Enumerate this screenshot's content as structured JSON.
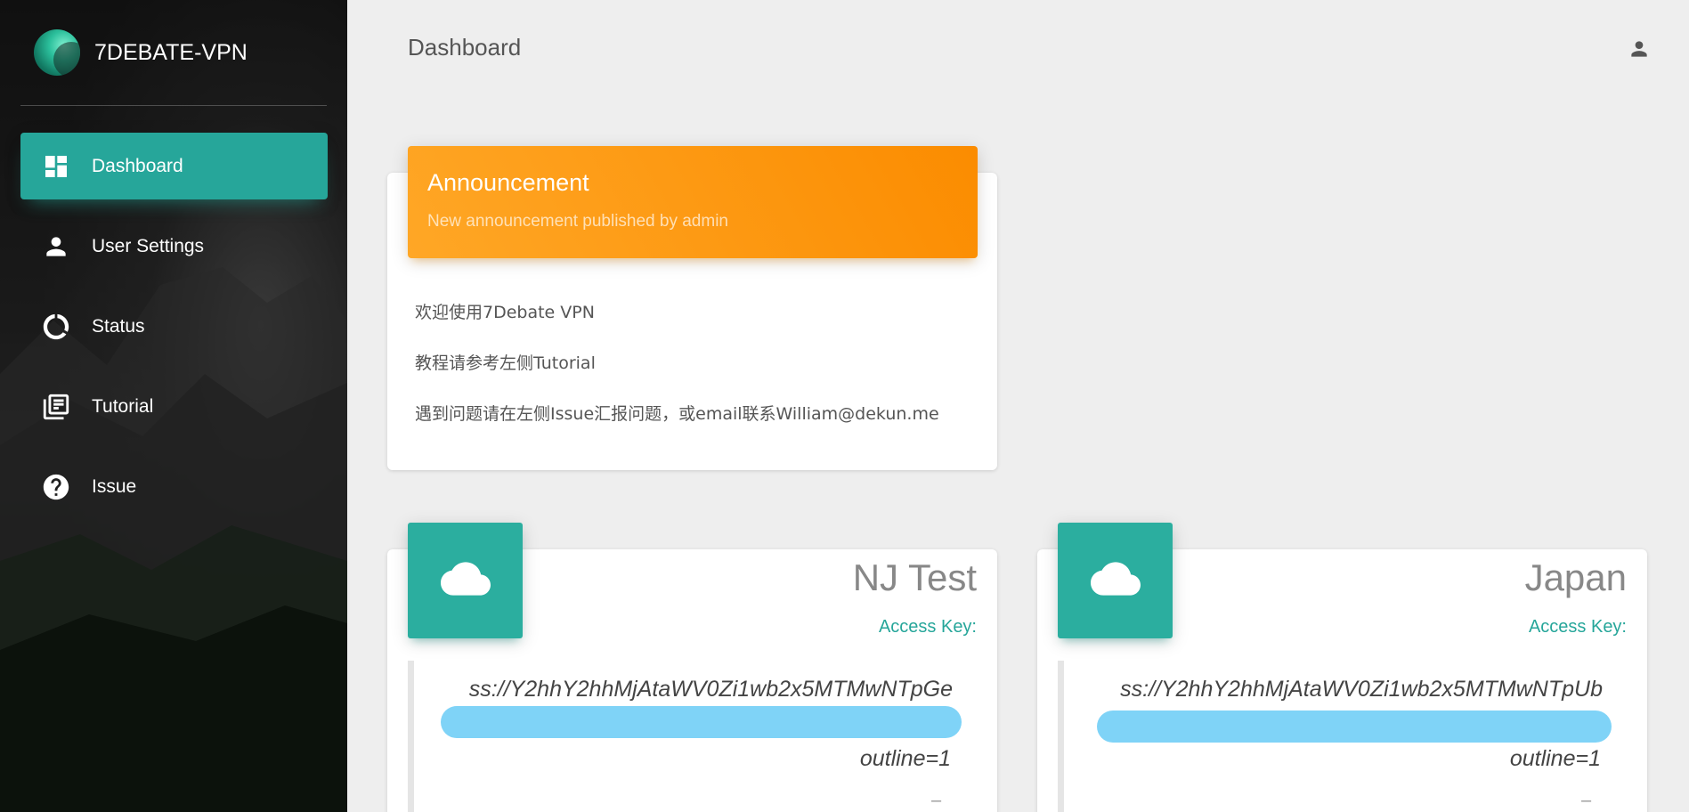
{
  "brand": {
    "name": "7DEBATE-VPN"
  },
  "sidebar": {
    "items": [
      {
        "label": "Dashboard",
        "icon": "dashboard-icon",
        "active": true
      },
      {
        "label": "User Settings",
        "icon": "person-icon",
        "active": false
      },
      {
        "label": "Status",
        "icon": "status-ring-icon",
        "active": false
      },
      {
        "label": "Tutorial",
        "icon": "library-books-icon",
        "active": false
      },
      {
        "label": "Issue",
        "icon": "help-circle-icon",
        "active": false
      }
    ]
  },
  "header": {
    "title": "Dashboard",
    "user_icon": "account-icon"
  },
  "announcement": {
    "title": "Announcement",
    "subtitle": "New announcement published by admin",
    "lines": [
      "欢迎使用7Debate VPN",
      "教程请参考左侧Tutorial",
      "遇到问题请在左侧Issue汇报问题，或email联系William@dekun.me"
    ]
  },
  "servers": [
    {
      "name": "NJ Test",
      "access_key_label": "Access Key:",
      "access_key_visible": "ss://Y2hhY2hhMjAtaWV0Zi1wb2x5MTMwNTpGe",
      "access_key_suffix": "outline=1",
      "icon": "cloud-icon",
      "dash": "–"
    },
    {
      "name": "Japan",
      "access_key_label": "Access Key:",
      "access_key_visible": "ss://Y2hhY2hhMjAtaWV0Zi1wb2x5MTMwNTpUb",
      "access_key_suffix": "outline=1",
      "icon": "cloud-icon",
      "dash": "–"
    }
  ],
  "colors": {
    "accent": "#26a69a",
    "announcement_orange": "#fb8c00",
    "redaction": "#7fd3f7",
    "background": "#eeeeee"
  }
}
